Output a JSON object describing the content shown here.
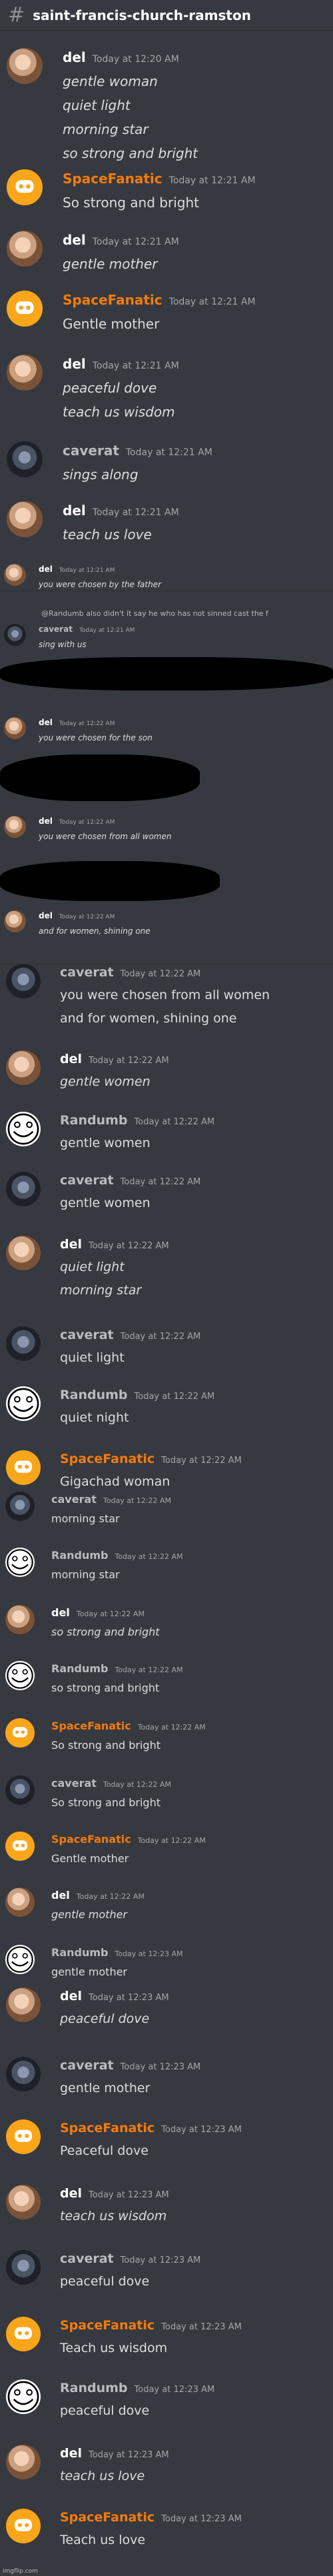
{
  "channel": {
    "icon": "hash-icon",
    "name": "saint-francis-church-ramston"
  },
  "colors": {
    "background": "#36393f",
    "spacefanatic": "#f47b0a",
    "timestamp": "#a3a6aa"
  },
  "messages": [
    {
      "author": "del",
      "time": "Today at 12:20 AM",
      "lines": [
        "gentle woman",
        "quiet light",
        "morning star",
        "so strong and bright"
      ],
      "italic": true
    },
    {
      "author": "SpaceFanatic",
      "time": "Today at 12:21 AM",
      "lines": [
        "So strong and bright"
      ]
    },
    {
      "author": "del",
      "time": "Today at 12:21 AM",
      "lines": [
        "gentle mother"
      ],
      "italic": true
    },
    {
      "author": "SpaceFanatic",
      "time": "Today at 12:21 AM",
      "lines": [
        "Gentle mother"
      ]
    },
    {
      "author": "del",
      "time": "Today at 12:21 AM",
      "lines": [
        "peaceful dove",
        "teach us wisdom"
      ],
      "italic": true
    },
    {
      "author": "caverat",
      "time": "Today at 12:21 AM",
      "lines": [
        "sings along"
      ],
      "italic": true
    },
    {
      "author": "del",
      "time": "Today at 12:21 AM",
      "lines": [
        "teach us love"
      ],
      "italic": true
    },
    {
      "author": "del",
      "time": "Today at 12:21 AM",
      "lines": [
        "you were chosen by the father"
      ],
      "italic": true
    },
    {
      "reply": "@Randumb also didn't it say he who has not sinned cast the f"
    },
    {
      "author": "caverat",
      "time": "Today at 12:21 AM",
      "lines": [
        "sing with us"
      ],
      "italic": true
    },
    {
      "author": "del",
      "time": "Today at 12:22 AM",
      "lines": [
        "you were chosen for the son"
      ],
      "italic": true
    },
    {
      "author": "del",
      "time": "Today at 12:22 AM",
      "lines": [
        "you were chosen from all women"
      ],
      "italic": true
    },
    {
      "author": "del",
      "time": "Today at 12:22 AM",
      "lines": [
        "and for women, shining one"
      ],
      "italic": true
    },
    {
      "author": "caverat",
      "time": "Today at 12:22 AM",
      "lines": [
        "you were chosen from all women",
        "and for women, shining one"
      ]
    },
    {
      "author": "del",
      "time": "Today at 12:22 AM",
      "lines": [
        "gentle women"
      ],
      "italic": true
    },
    {
      "author": "Randumb",
      "time": "Today at 12:22 AM",
      "lines": [
        "gentle women"
      ]
    },
    {
      "author": "caverat",
      "time": "Today at 12:22 AM",
      "lines": [
        "gentle women"
      ]
    },
    {
      "author": "del",
      "time": "Today at 12:22 AM",
      "lines": [
        "quiet light",
        "morning star"
      ],
      "italic": true
    },
    {
      "author": "caverat",
      "time": "Today at 12:22 AM",
      "lines": [
        "quiet light"
      ]
    },
    {
      "author": "Randumb",
      "time": "Today at 12:22 AM",
      "lines": [
        "quiet night"
      ]
    },
    {
      "author": "SpaceFanatic",
      "time": "Today at 12:22 AM",
      "lines": [
        "Gigachad woman"
      ]
    },
    {
      "author": "caverat",
      "time": "Today at 12:22 AM",
      "lines": [
        "morning star"
      ]
    },
    {
      "author": "Randumb",
      "time": "Today at 12:22 AM",
      "lines": [
        "morning star"
      ]
    },
    {
      "author": "del",
      "time": "Today at 12:22 AM",
      "lines": [
        "so strong and bright"
      ],
      "italic": true
    },
    {
      "author": "Randumb",
      "time": "Today at 12:22 AM",
      "lines": [
        "so strong and bright"
      ]
    },
    {
      "author": "SpaceFanatic",
      "time": "Today at 12:22 AM",
      "lines": [
        "So strong and bright"
      ]
    },
    {
      "author": "caverat",
      "time": "Today at 12:22 AM",
      "lines": [
        "So strong and bright"
      ]
    },
    {
      "author": "SpaceFanatic",
      "time": "Today at 12:22 AM",
      "lines": [
        "Gentle mother"
      ]
    },
    {
      "author": "del",
      "time": "Today at 12:22 AM",
      "lines": [
        "gentle mother"
      ],
      "italic": true
    },
    {
      "author": "Randumb",
      "time": "Today at 12:23 AM",
      "lines": [
        "gentle mother"
      ]
    },
    {
      "author": "del",
      "time": "Today at 12:23 AM",
      "lines": [
        "peaceful dove"
      ],
      "italic": true
    },
    {
      "author": "caverat",
      "time": "Today at 12:23 AM",
      "lines": [
        "gentle mother"
      ]
    },
    {
      "author": "SpaceFanatic",
      "time": "Today at 12:23 AM",
      "lines": [
        "Peaceful dove"
      ]
    },
    {
      "author": "del",
      "time": "Today at 12:23 AM",
      "lines": [
        "teach us wisdom"
      ],
      "italic": true
    },
    {
      "author": "caverat",
      "time": "Today at 12:23 AM",
      "lines": [
        "peaceful dove"
      ]
    },
    {
      "author": "SpaceFanatic",
      "time": "Today at 12:23 AM",
      "lines": [
        "Teach us wisdom"
      ]
    },
    {
      "author": "Randumb",
      "time": "Today at 12:23 AM",
      "lines": [
        "peaceful dove"
      ]
    },
    {
      "author": "del",
      "time": "Today at 12:23 AM",
      "lines": [
        "teach us love"
      ],
      "italic": true
    },
    {
      "author": "SpaceFanatic",
      "time": "Today at 12:23 AM",
      "lines": [
        "Teach us love"
      ]
    }
  ],
  "footer_mark": "imgflip.com"
}
